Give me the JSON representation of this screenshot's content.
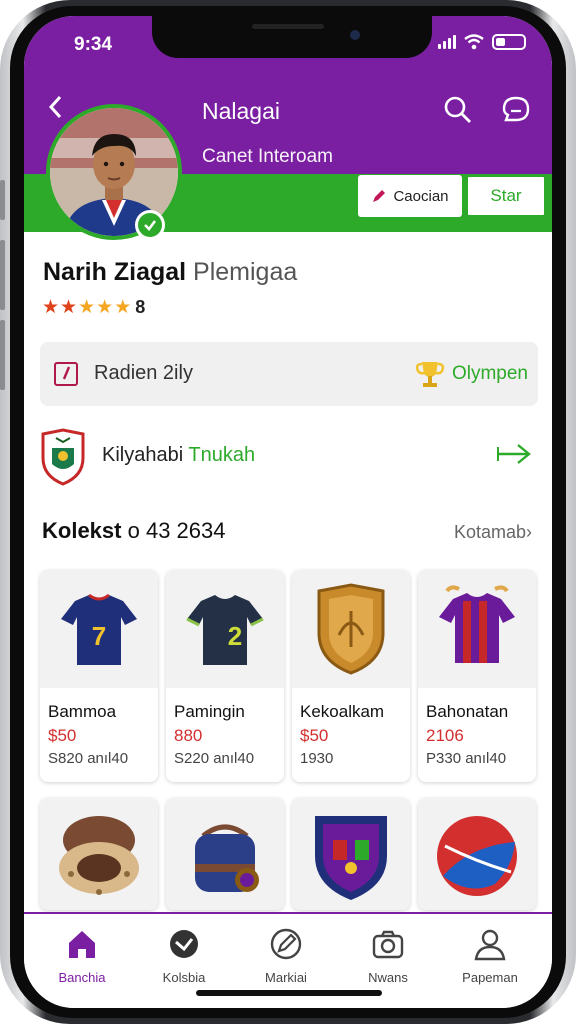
{
  "status": {
    "time": "9:34"
  },
  "header": {
    "title": "Nalagai",
    "subtitle": "Canet Interoam",
    "secondary_button": "Caocian",
    "primary_button": "Star"
  },
  "profile": {
    "name": "Narih Ziagal",
    "name_suffix": "Plemigaa",
    "rating": 5,
    "rating_count": "8"
  },
  "rank": {
    "label": "Radien 2ily",
    "badge": "Olympen"
  },
  "club": {
    "name": "Kilyahabi",
    "highlight": "Tnukah"
  },
  "collection": {
    "title": "Kolekst",
    "count": "o 43 2634",
    "see_more": "Kotamab",
    "items": [
      {
        "title": "Bammoa",
        "price": "$50",
        "meta": "S820  anıl40",
        "icon": "navy-jersey-icon"
      },
      {
        "title": "Pamingin",
        "price": "880",
        "meta": "S220  anıl40",
        "icon": "dark-jersey-icon"
      },
      {
        "title": "Kekoalkam",
        "price": "$50",
        "meta": "1930",
        "icon": "gold-crest-icon"
      },
      {
        "title": "Bahonatan",
        "price": "2106",
        "meta": "P330  anıl40",
        "icon": "striped-jersey-icon"
      },
      {
        "icon": "helmet-icon"
      },
      {
        "icon": "bag-icon"
      },
      {
        "icon": "club-badge-icon"
      },
      {
        "icon": "ball-icon"
      }
    ]
  },
  "tabs": [
    {
      "label": "Banchia",
      "icon": "home-icon",
      "active": true
    },
    {
      "label": "Kolsbia",
      "icon": "shield-icon",
      "active": false
    },
    {
      "label": "Markiai",
      "icon": "edit-icon",
      "active": false
    },
    {
      "label": "Nwans",
      "icon": "camera-icon",
      "active": false
    },
    {
      "label": "Papeman",
      "icon": "user-icon",
      "active": false
    }
  ],
  "colors": {
    "primary": "#7b1fa2",
    "accent": "#2eaa2a",
    "price": "#d32f2f"
  }
}
